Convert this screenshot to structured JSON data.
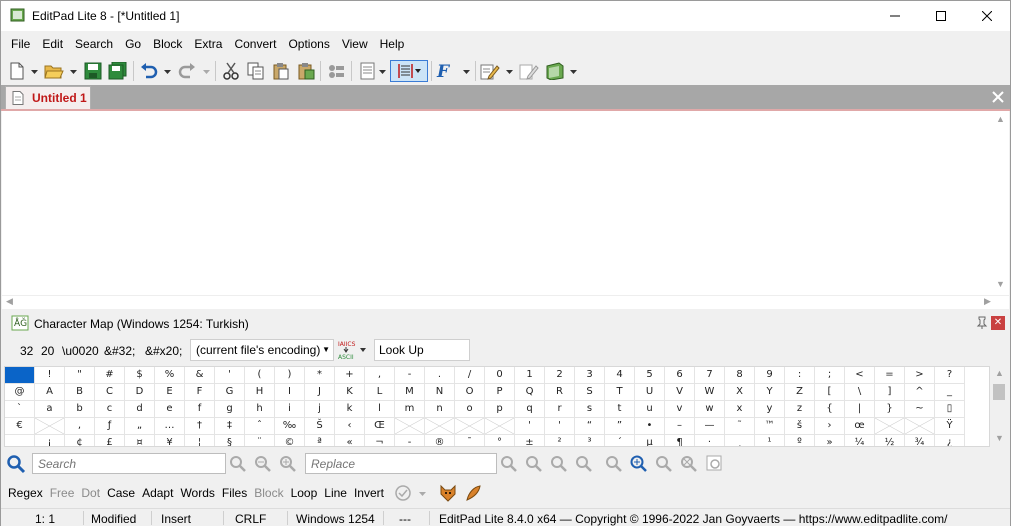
{
  "window": {
    "title": "EditPad Lite 8 - [*Untitled 1]"
  },
  "menu": [
    "File",
    "Edit",
    "Search",
    "Go",
    "Block",
    "Extra",
    "Convert",
    "Options",
    "View",
    "Help"
  ],
  "tabs": [
    {
      "label": "Untitled 1"
    }
  ],
  "charmap": {
    "title": "Character Map (Windows 1254: Turkish)",
    "info": {
      "decimal": "32",
      "hex": "20",
      "escape": "\\u0020",
      "html_dec": "&#32;",
      "html_hex": "&#x20;"
    },
    "encoding": "(current file's encoding)",
    "lookup_label": "Look Up",
    "convert_icon_text": [
      "IAIICS",
      "ASCII"
    ],
    "rows": [
      [
        "",
        "!",
        "\"",
        "#",
        "$",
        "%",
        "&",
        "'",
        "(",
        ")",
        "*",
        "+",
        ",",
        "-",
        ".",
        "/",
        "0",
        "1",
        "2",
        "3",
        "4",
        "5",
        "6",
        "7",
        "8",
        "9",
        ":",
        ";",
        "<",
        "=",
        ">",
        "?"
      ],
      [
        "@",
        "A",
        "B",
        "C",
        "D",
        "E",
        "F",
        "G",
        "H",
        "I",
        "J",
        "K",
        "L",
        "M",
        "N",
        "O",
        "P",
        "Q",
        "R",
        "S",
        "T",
        "U",
        "V",
        "W",
        "X",
        "Y",
        "Z",
        "[",
        "\\",
        "]",
        "^",
        "_"
      ],
      [
        "`",
        "a",
        "b",
        "c",
        "d",
        "e",
        "f",
        "g",
        "h",
        "i",
        "j",
        "k",
        "l",
        "m",
        "n",
        "o",
        "p",
        "q",
        "r",
        "s",
        "t",
        "u",
        "v",
        "w",
        "x",
        "y",
        "z",
        "{",
        "|",
        "}",
        "~",
        "▯"
      ],
      [
        "€",
        "×",
        ",",
        "ƒ",
        "„",
        "…",
        "†",
        "‡",
        "ˆ",
        "‰",
        "Š",
        "‹",
        "Œ",
        "×",
        "×",
        "×",
        "×",
        "'",
        "'",
        "“",
        "”",
        "•",
        "–",
        "—",
        "˜",
        "™",
        "š",
        "›",
        "œ",
        "×",
        "×",
        "Ÿ"
      ],
      [
        "",
        "¡",
        "¢",
        "£",
        "¤",
        "¥",
        "¦",
        "§",
        "¨",
        "©",
        "ª",
        "«",
        "¬",
        "-",
        "®",
        "¯",
        "°",
        "±",
        "²",
        "³",
        "´",
        "µ",
        "¶",
        "·",
        "¸",
        "¹",
        "º",
        "»",
        "¼",
        "½",
        "¾",
        "¿"
      ]
    ]
  },
  "search": {
    "search_placeholder": "Search",
    "replace_placeholder": "Replace",
    "options": [
      {
        "label": "Regex",
        "enabled": true
      },
      {
        "label": "Free",
        "enabled": false
      },
      {
        "label": "Dot",
        "enabled": false
      },
      {
        "label": "Case",
        "enabled": true
      },
      {
        "label": "Adapt",
        "enabled": true
      },
      {
        "label": "Words",
        "enabled": true
      },
      {
        "label": "Files",
        "enabled": true
      },
      {
        "label": "Block",
        "enabled": false
      },
      {
        "label": "Loop",
        "enabled": true
      },
      {
        "label": "Line",
        "enabled": true
      },
      {
        "label": "Invert",
        "enabled": true
      }
    ]
  },
  "status": {
    "position": "1: 1",
    "modified": "Modified",
    "insert": "Insert",
    "line_break": "CRLF",
    "encoding": "Windows 1254",
    "extra": "---",
    "copyright": "EditPad Lite 8.4.0 x64 — Copyright © 1996-2022 Jan Goyvaerts — https://www.editpadlite.com/"
  },
  "colors": {
    "tab_label": "#c01818",
    "selected_cell": "#0a64c8",
    "tabstrip": "#a7a7a7"
  }
}
